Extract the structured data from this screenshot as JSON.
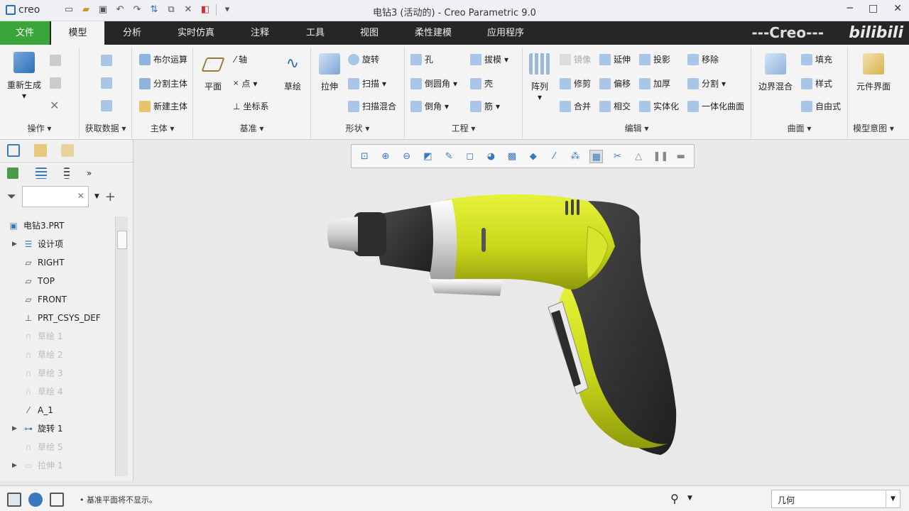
{
  "window": {
    "app_logo": "creo",
    "title": "电钻3 (活动的) - Creo Parametric 9.0",
    "controls": [
      "─",
      "□",
      "✕"
    ]
  },
  "tabs": [
    {
      "label": "文件"
    },
    {
      "label": "模型"
    },
    {
      "label": "分析"
    },
    {
      "label": "实时仿真"
    },
    {
      "label": "注释"
    },
    {
      "label": "工具"
    },
    {
      "label": "视图"
    },
    {
      "label": "柔性建模"
    },
    {
      "label": "应用程序"
    }
  ],
  "branding": {
    "creo_banner": "---Creo---",
    "watermark": "bilibili"
  },
  "ribbon": {
    "operations": {
      "label": "操作",
      "regenerate": "重新生成"
    },
    "get_data": {
      "label": "获取数据"
    },
    "body": {
      "label": "主体",
      "boolean": "布尔运算",
      "split": "分割主体",
      "new_body": "新建主体"
    },
    "datum": {
      "label": "基准",
      "plane": "平面",
      "axis": "轴",
      "point": "点",
      "csys": "坐标系",
      "sketch": "草绘"
    },
    "shapes": {
      "label": "形状",
      "extrude": "拉伸",
      "revolve": "旋转",
      "sweep": "扫描",
      "swept_blend": "扫描混合"
    },
    "engineering": {
      "label": "工程",
      "hole": "孔",
      "round": "倒圆角",
      "chamfer": "倒角",
      "draft": "拔模",
      "shell": "壳",
      "rib": "筋"
    },
    "editing": {
      "label": "编辑",
      "pattern": "阵列",
      "mirror": "镜像",
      "trim": "修剪",
      "merge": "合并",
      "extend": "延伸",
      "offset": "偏移",
      "intersect": "相交",
      "project": "投影",
      "thicken": "加厚",
      "solidify": "实体化",
      "remove": "移除",
      "split": "分割",
      "unify_surface": "一体化曲面"
    },
    "surfaces": {
      "label": "曲面",
      "boundary_blend": "边界混合",
      "fill": "填充",
      "style": "样式",
      "freestyle": "自由式"
    },
    "model_intent": {
      "label": "模型意图",
      "component_interface": "元件界面"
    }
  },
  "tree": {
    "items": [
      {
        "label": "电钻3.PRT",
        "icon": "part-icon"
      },
      {
        "label": "设计项",
        "icon": "design-items-icon"
      },
      {
        "label": "RIGHT",
        "icon": "datum-plane-icon"
      },
      {
        "label": "TOP",
        "icon": "datum-plane-icon"
      },
      {
        "label": "FRONT",
        "icon": "datum-plane-icon"
      },
      {
        "label": "PRT_CSYS_DEF",
        "icon": "csys-icon"
      },
      {
        "label": "草绘 1",
        "icon": "sketch-icon"
      },
      {
        "label": "草绘 2",
        "icon": "sketch-icon"
      },
      {
        "label": "草绘 3",
        "icon": "sketch-icon"
      },
      {
        "label": "草绘 4",
        "icon": "sketch-icon"
      },
      {
        "label": "A_1",
        "icon": "axis-icon"
      },
      {
        "label": "旋转 1",
        "icon": "revolve-icon"
      },
      {
        "label": "草绘 5",
        "icon": "sketch-icon"
      },
      {
        "label": "拉伸 1",
        "icon": "extrude-icon"
      }
    ]
  },
  "status": {
    "message": "基准平面将不显示。",
    "filter_value": "几何"
  }
}
